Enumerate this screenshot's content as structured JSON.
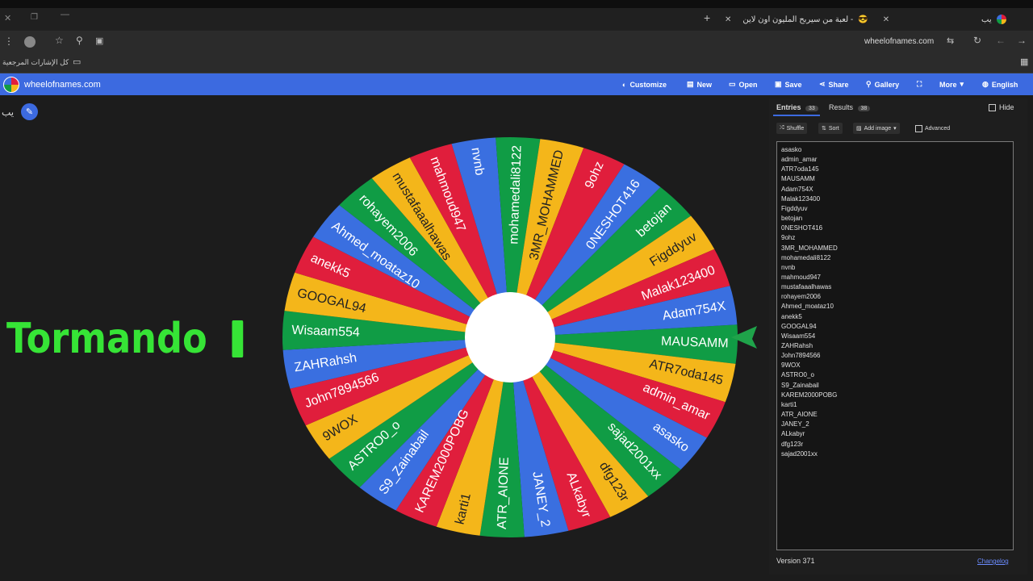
{
  "browser": {
    "tabs": [
      {
        "label": "لعبة من سيربح المليون اون لاين -"
      },
      {
        "label": "يب"
      }
    ],
    "url": "wheelofnames.com",
    "bookmarks_label": "كل الإشارات المرجعية"
  },
  "site": {
    "logo_text": "wheelofnames.com",
    "nav": {
      "customize": "Customize",
      "new": "New",
      "open": "Open",
      "save": "Save",
      "share": "Share",
      "gallery": "Gallery",
      "more": "More",
      "language": "English"
    }
  },
  "wheel_title": "يب",
  "overlay_text": "Tormando",
  "panel": {
    "entries_tab": "Entries",
    "entries_count": "33",
    "results_tab": "Results",
    "results_count": "38",
    "hide_label": "Hide",
    "shuffle_label": "Shuffle",
    "sort_label": "Sort",
    "add_image_label": "Add image",
    "advanced_label": "Advanced",
    "version": "Version 371",
    "changelog": "Changelog"
  },
  "entries": [
    "asasko",
    "admin_amar",
    "ATR7oda145",
    "MAUSAMM",
    "Adam754X",
    "Malak123400",
    "Figddyuv",
    "betojan",
    "0NESHOT416",
    "9ohz",
    "3MR_MOHAMMED",
    "mohamedali8122",
    "nvnb",
    "mahmoud947",
    "mustafaaalhawas",
    "rohayem2006",
    "Ahmed_moataz10",
    "anekk5",
    "GOOGAL94",
    "Wisaam554",
    "ZAHRahsh",
    "John7894566",
    "9WOX",
    "ASTRO0_o",
    "S9_Zainabail",
    "KAREM2000POBG",
    "karti1",
    "ATR_AIONE",
    "JANEY_2",
    "ALkabyr",
    "dfg123r",
    "sajad2001xx"
  ],
  "wheel": {
    "colors": [
      "#3a6fe0",
      "#109c45",
      "#f4b61a",
      "#e01e3c"
    ],
    "rotation_deg": 2,
    "segments": [
      "MAUSAMM",
      "ATR7oda145",
      "admin_amar",
      "asasko",
      "sajad2001xx",
      "dfg123r",
      "ALkabyr",
      "JANEY_2",
      "ATR_AIONE",
      "karti1",
      "KAREM2000POBG",
      "S9_Zainabail",
      "ASTRO0_o",
      "9WOX",
      "John7894566",
      "ZAHRahsh",
      "Wisaam554",
      "GOOGAL94",
      "anekk5",
      "Ahmed_moataz10",
      "rohayem2006",
      "mustafaaalhawas",
      "mahmoud947",
      "nvnb",
      "mohamedali8122",
      "3MR_MOHAMMED",
      "9ohz",
      "0NESHOT416",
      "betojan",
      "Figddyuv",
      "Malak123400",
      "Adam754X"
    ],
    "segment_colors": [
      "#109c45",
      "#f4b61a",
      "#e01e3c",
      "#3a6fe0",
      "#109c45",
      "#f4b61a",
      "#e01e3c",
      "#3a6fe0",
      "#109c45",
      "#f4b61a",
      "#e01e3c",
      "#3a6fe0",
      "#109c45",
      "#f4b61a",
      "#e01e3c",
      "#3a6fe0",
      "#109c45",
      "#f4b61a",
      "#e01e3c",
      "#3a6fe0",
      "#109c45",
      "#f4b61a",
      "#e01e3c",
      "#3a6fe0",
      "#109c45",
      "#f4b61a",
      "#e01e3c",
      "#3a6fe0",
      "#109c45",
      "#f4b61a",
      "#e01e3c",
      "#3a6fe0"
    ]
  }
}
